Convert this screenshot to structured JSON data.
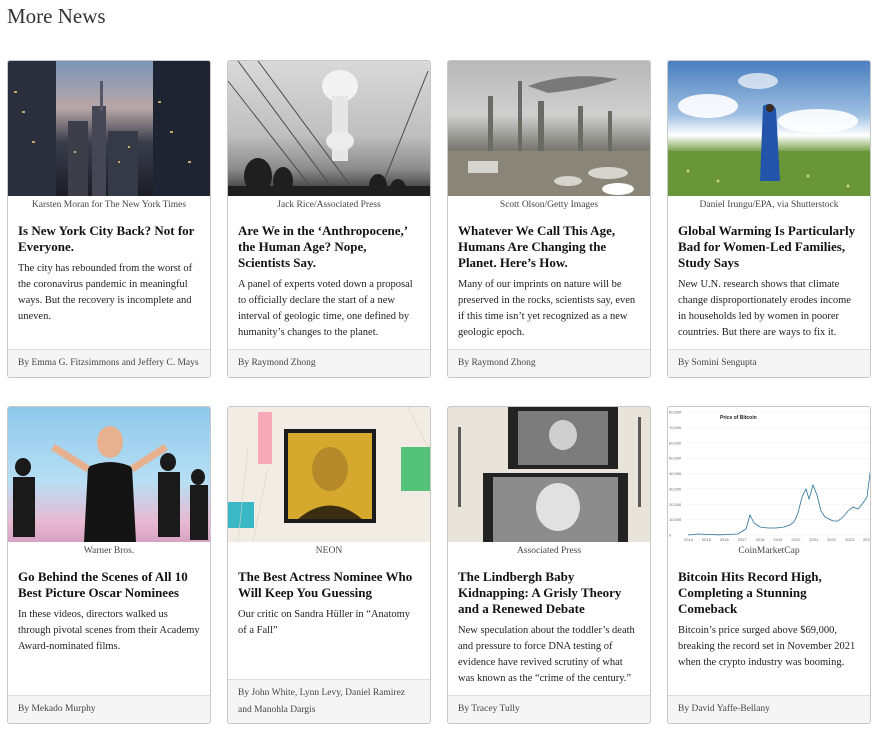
{
  "section": {
    "title": "More News"
  },
  "cards": [
    {
      "credit": "Karsten Moran for The New York Times",
      "headline": "Is New York City Back? Not for Everyone.",
      "summary": "The city has rebounded from the worst of the coronavirus pandemic in meaningful ways. But the recovery is incomplete and uneven.",
      "byline": "By Emma G. Fitzsimmons and Jeffery C. Mays"
    },
    {
      "credit": "Jack Rice/Associated Press",
      "headline": "Are We in the ‘Anthropocene,’ the Human Age? Nope, Scientists Say.",
      "summary": "A panel of experts voted down a proposal to officially declare the start of a new interval of geologic time, one defined by humanity’s changes to the planet.",
      "byline": "By Raymond Zhong"
    },
    {
      "credit": "Scott Olson/Getty Images",
      "headline": "Whatever We Call This Age, Humans Are Changing the Planet. Here’s How.",
      "summary": "Many of our imprints on nature will be preserved in the rocks, scientists say, even if this time isn’t yet recognized as a new geologic epoch.",
      "byline": "By Raymond Zhong"
    },
    {
      "credit": "Daniel Irungu/EPA, via Shutterstock",
      "headline": "Global Warming Is Particularly Bad for Women-Led Families, Study Says",
      "summary": "New U.N. research shows that climate change disproportionately erodes income in households led by women in poorer countries. But there are ways to fix it.",
      "byline": "By Somini Sengupta"
    },
    {
      "credit": "Warner Bros.",
      "headline": "Go Behind the Scenes of All 10 Best Picture Oscar Nominees",
      "summary": "In these videos, directors walked us through pivotal scenes from their Academy Award-nominated films.",
      "byline": "By Mekado Murphy"
    },
    {
      "credit": "NEON",
      "headline": "The Best Actress Nominee Who Will Keep You Guessing",
      "summary": "Our critic on Sandra Hüller in “Anatomy of a Fall”",
      "byline": "By John White, Lynn Levy, Daniel Ramirez and Manohla Dargis"
    },
    {
      "credit": "Associated Press",
      "headline": "The Lindbergh Baby Kidnapping: A Grisly Theory and a Renewed Debate",
      "summary": "New speculation about the toddler’s death and pressure to force DNA testing of evidence have revived scrutiny of what was known as the “crime of the century.”",
      "byline": "By Tracey Tully"
    },
    {
      "credit": "CoinMarketCap",
      "headline": "Bitcoin Hits Record High, Completing a Stunning Comeback",
      "summary": "Bitcoin’s price surged above $69,000, breaking the record set in November 2021 when the crypto industry was booming.",
      "byline": "By David Yaffe-Bellany"
    }
  ],
  "btc_image": {
    "title": "Price of Bitcoin",
    "yticks": [
      "80,000",
      "70,000",
      "60,000",
      "50,000",
      "40,000",
      "30,000",
      "20,000",
      "10,000",
      "0"
    ],
    "xticks": [
      "2014",
      "2015",
      "2016",
      "2017",
      "2018",
      "2019",
      "2020",
      "2021",
      "2022",
      "2023",
      "2024"
    ],
    "line_color": "#2a6f97"
  }
}
